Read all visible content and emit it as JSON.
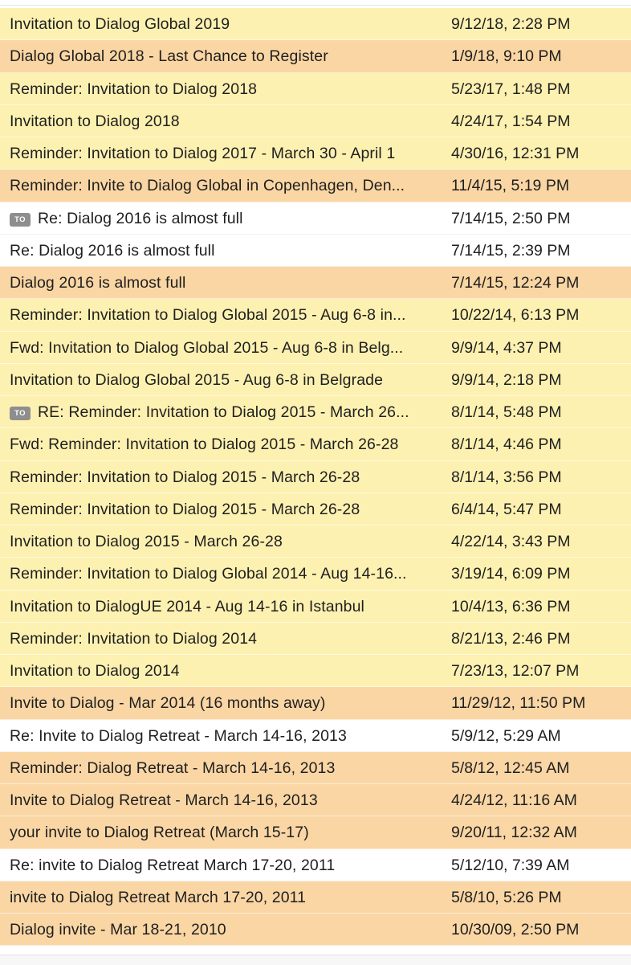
{
  "colors": {
    "yellow": "#fdf1b1",
    "orange": "#fad6a4",
    "white": "#ffffff",
    "badge": "#8e8e8e"
  },
  "messages": [
    {
      "subject": "Invitation to Dialog Global 2019",
      "date": "9/12/18, 2:28 PM",
      "color": "yellow"
    },
    {
      "subject": "Dialog Global 2018 - Last Chance to Register",
      "date": "1/9/18, 9:10 PM",
      "color": "orange"
    },
    {
      "subject": "Reminder: Invitation to Dialog 2018",
      "date": "5/23/17, 1:48 PM",
      "color": "yellow"
    },
    {
      "subject": "Invitation to Dialog 2018",
      "date": "4/24/17, 1:54 PM",
      "color": "yellow"
    },
    {
      "subject": "Reminder: Invitation to Dialog 2017 - March 30 - April 1",
      "date": "4/30/16, 12:31 PM",
      "color": "yellow"
    },
    {
      "subject": "Reminder: Invite to Dialog Global in Copenhagen, Den...",
      "date": "11/4/15, 5:19 PM",
      "color": "orange"
    },
    {
      "subject": "Re: Dialog 2016 is almost full",
      "date": "7/14/15, 2:50 PM",
      "color": "white",
      "badge": "TO"
    },
    {
      "subject": "Re: Dialog 2016 is almost full",
      "date": "7/14/15, 2:39 PM",
      "color": "white"
    },
    {
      "subject": "Dialog 2016 is almost full",
      "date": "7/14/15, 12:24 PM",
      "color": "orange"
    },
    {
      "subject": "Reminder: Invitation to Dialog Global 2015 - Aug 6-8 in...",
      "date": "10/22/14, 6:13 PM",
      "color": "yellow"
    },
    {
      "subject": "Fwd: Invitation to Dialog Global 2015 - Aug 6-8 in Belg...",
      "date": "9/9/14, 4:37 PM",
      "color": "yellow"
    },
    {
      "subject": "Invitation to Dialog Global 2015 - Aug 6-8 in Belgrade",
      "date": "9/9/14, 2:18 PM",
      "color": "yellow"
    },
    {
      "subject": "RE: Reminder: Invitation to Dialog 2015 - March 26...",
      "date": "8/1/14, 5:48 PM",
      "color": "yellow",
      "badge": "TO"
    },
    {
      "subject": "Fwd: Reminder: Invitation to Dialog 2015 - March 26-28",
      "date": "8/1/14, 4:46 PM",
      "color": "yellow"
    },
    {
      "subject": "Reminder: Invitation to Dialog 2015 - March 26-28",
      "date": "8/1/14, 3:56 PM",
      "color": "yellow"
    },
    {
      "subject": "Reminder: Invitation to Dialog 2015 - March 26-28",
      "date": "6/4/14, 5:47 PM",
      "color": "yellow"
    },
    {
      "subject": "Invitation to Dialog 2015 - March 26-28",
      "date": "4/22/14, 3:43 PM",
      "color": "yellow"
    },
    {
      "subject": "Reminder: Invitation to Dialog Global 2014 - Aug 14-16...",
      "date": "3/19/14, 6:09 PM",
      "color": "yellow"
    },
    {
      "subject": "Invitation to DialogUE 2014 - Aug 14-16 in Istanbul",
      "date": "10/4/13, 6:36 PM",
      "color": "yellow"
    },
    {
      "subject": "Reminder: Invitation to Dialog 2014",
      "date": "8/21/13, 2:46 PM",
      "color": "yellow"
    },
    {
      "subject": "Invitation to Dialog 2014",
      "date": "7/23/13, 12:07 PM",
      "color": "yellow"
    },
    {
      "subject": "Invite to Dialog - Mar 2014 (16 months away)",
      "date": "11/29/12, 11:50 PM",
      "color": "orange"
    },
    {
      "subject": "Re: Invite to Dialog Retreat - March 14-16, 2013",
      "date": "5/9/12, 5:29 AM",
      "color": "white"
    },
    {
      "subject": "Reminder: Dialog Retreat - March 14-16, 2013",
      "date": "5/8/12, 12:45 AM",
      "color": "orange"
    },
    {
      "subject": "Invite to Dialog Retreat - March 14-16, 2013",
      "date": "4/24/12, 11:16 AM",
      "color": "orange"
    },
    {
      "subject": "your invite to Dialog Retreat (March 15-17)",
      "date": "9/20/11, 12:32 AM",
      "color": "orange"
    },
    {
      "subject": "Re: invite to Dialog Retreat March 17-20, 2011",
      "date": "5/12/10, 7:39 AM",
      "color": "white"
    },
    {
      "subject": "invite to Dialog Retreat March 17-20, 2011",
      "date": "5/8/10, 5:26 PM",
      "color": "orange"
    },
    {
      "subject": "Dialog invite - Mar 18-21, 2010",
      "date": "10/30/09, 2:50 PM",
      "color": "orange"
    }
  ]
}
